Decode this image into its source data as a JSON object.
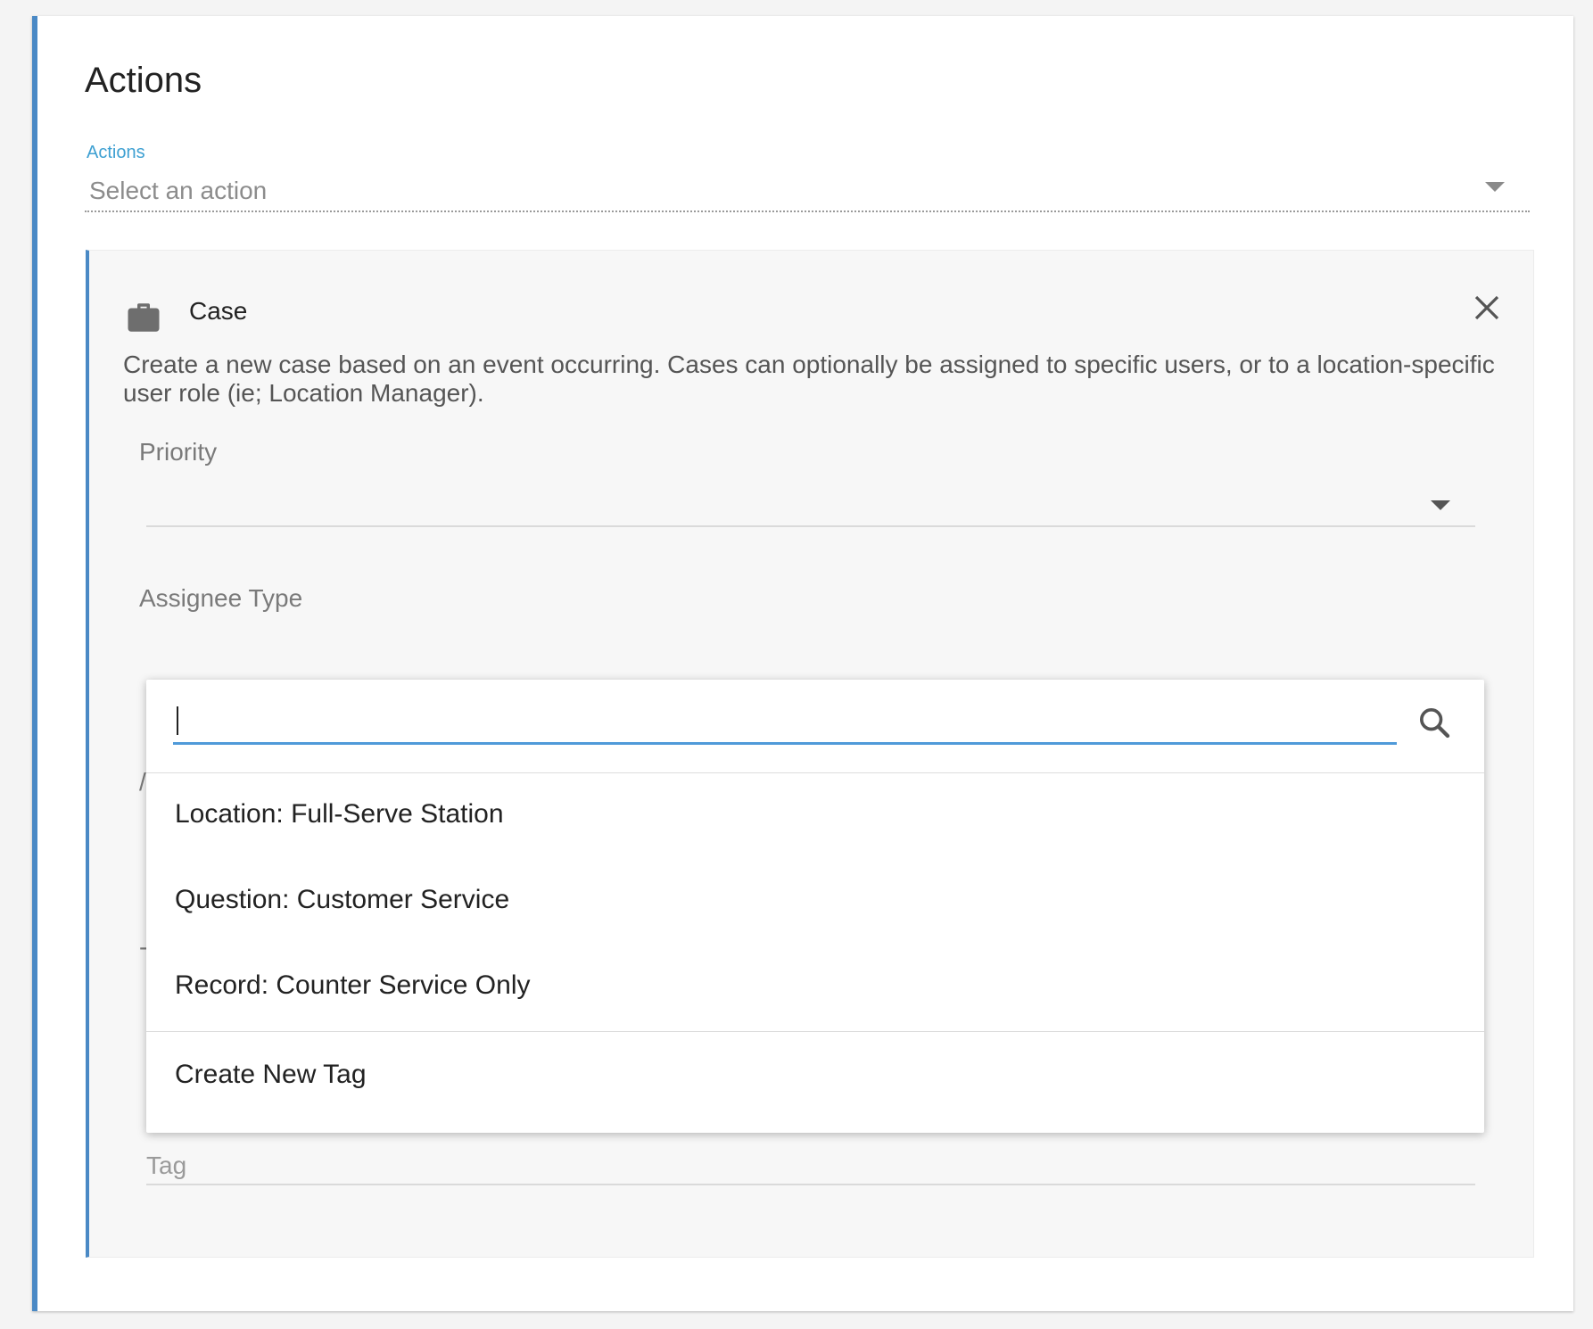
{
  "section": {
    "title": "Actions"
  },
  "actions_select": {
    "label": "Actions",
    "placeholder": "Select an action"
  },
  "case_panel": {
    "icon": "briefcase-icon",
    "title": "Case",
    "description": "Create a new case based on an event occurring. Cases can optionally be assigned to specific users, or to a location-specific user role (ie; Location Manager).",
    "priority_label": "Priority",
    "priority_value": "",
    "assignee_type_label": "Assignee Type",
    "tag_placeholder": "Tag"
  },
  "dropdown": {
    "search_value": "",
    "search_icon": "search-icon",
    "options": [
      "Location: Full-Serve Station",
      "Question: Customer Service",
      "Record: Counter Service Only"
    ],
    "create_label": "Create New Tag"
  },
  "colors": {
    "accent": "#4a89c5",
    "label_blue": "#3ea0d2",
    "search_underline": "#4f9ad9"
  }
}
